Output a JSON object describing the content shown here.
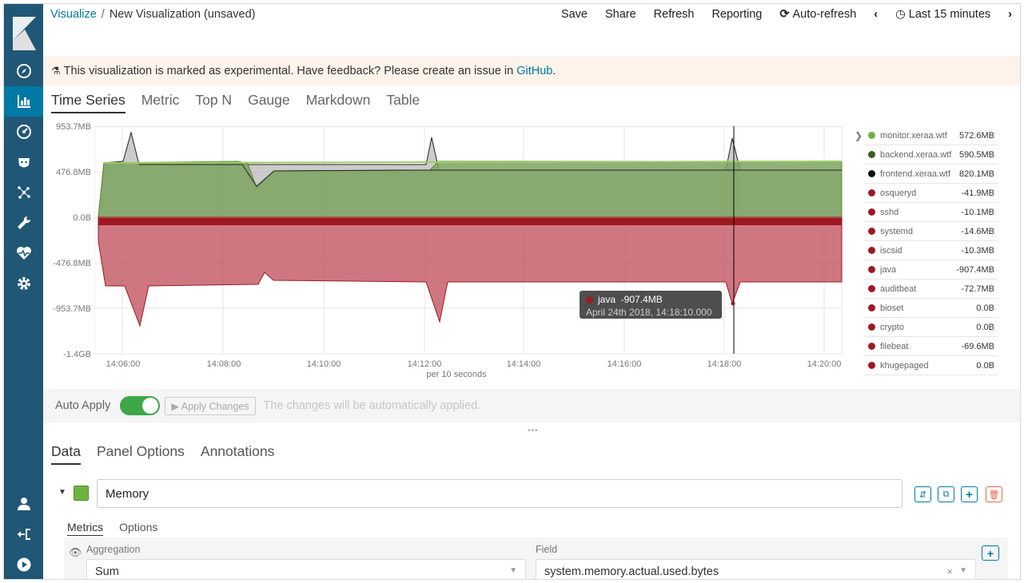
{
  "breadcrumb": {
    "parent": "Visualize",
    "separator": "/",
    "current": "New Visualization (unsaved)"
  },
  "top_actions": {
    "save": "Save",
    "share": "Share",
    "refresh": "Refresh",
    "reporting": "Reporting",
    "auto_refresh": "Auto-refresh",
    "time_range": "Last 15 minutes"
  },
  "banner": {
    "text": "This visualization is marked as experimental. Have feedback? Please create an issue in",
    "link": "GitHub",
    "suffix": "."
  },
  "type_tabs": [
    "Time Series",
    "Metric",
    "Top N",
    "Gauge",
    "Markdown",
    "Table"
  ],
  "chart_data": {
    "type": "area",
    "ylabel_ticks": [
      "953.7MB",
      "476.8MB",
      "0.0B",
      "-476.8MB",
      "-953.7MB",
      "-1.4GB"
    ],
    "x_ticks": [
      "14:06:00",
      "14:08:00",
      "14:10:00",
      "14:12:00",
      "14:14:00",
      "14:16:00",
      "14:18:00",
      "14:20:00"
    ],
    "xlabel": "per 10 seconds",
    "series": [
      {
        "name": "monitor.xeraa.wtf",
        "color": "#6db33f"
      },
      {
        "name": "backend.xeraa.wtf",
        "color": "#3b5e1f"
      },
      {
        "name": "frontend.xeraa.wtf",
        "color": "#111111"
      },
      {
        "name": "java",
        "color": "#9e1822"
      }
    ]
  },
  "tooltip": {
    "series": "java",
    "value": "-907.4MB",
    "time": "April 24th 2018, 14:18:10.000"
  },
  "legend": [
    {
      "name": "monitor.xeraa.wtf",
      "value": "572.6MB",
      "color": "#6db33f"
    },
    {
      "name": "backend.xeraa.wtf",
      "value": "590.5MB",
      "color": "#3b5e1f"
    },
    {
      "name": "frontend.xeraa.wtf",
      "value": "820.1MB",
      "color": "#111111"
    },
    {
      "name": "osqueryd",
      "value": "-41.9MB",
      "color": "#9e1822"
    },
    {
      "name": "sshd",
      "value": "-10.1MB",
      "color": "#9e1822"
    },
    {
      "name": "systemd",
      "value": "-14.6MB",
      "color": "#9e1822"
    },
    {
      "name": "iscsid",
      "value": "-10.3MB",
      "color": "#9e1822"
    },
    {
      "name": "java",
      "value": "-907.4MB",
      "color": "#9e1822"
    },
    {
      "name": "auditbeat",
      "value": "-72.7MB",
      "color": "#9e1822"
    },
    {
      "name": "bioset",
      "value": "0.0B",
      "color": "#9e1822"
    },
    {
      "name": "crypto",
      "value": "0.0B",
      "color": "#9e1822"
    },
    {
      "name": "filebeat",
      "value": "-69.6MB",
      "color": "#9e1822"
    },
    {
      "name": "khugepaged",
      "value": "0.0B",
      "color": "#9e1822"
    }
  ],
  "apply_bar": {
    "label": "Auto Apply",
    "button": "Apply Changes",
    "message": "The changes will be automatically applied."
  },
  "editor_tabs": [
    "Data",
    "Panel Options",
    "Annotations"
  ],
  "series_editor": {
    "label": "Memory",
    "swatch_color": "#6fb43f"
  },
  "sub_tabs": [
    "Metrics",
    "Options"
  ],
  "aggregation": {
    "label": "Aggregation",
    "value": "Sum",
    "field_label": "Field",
    "field_value": "system.memory.actual.used.bytes"
  }
}
